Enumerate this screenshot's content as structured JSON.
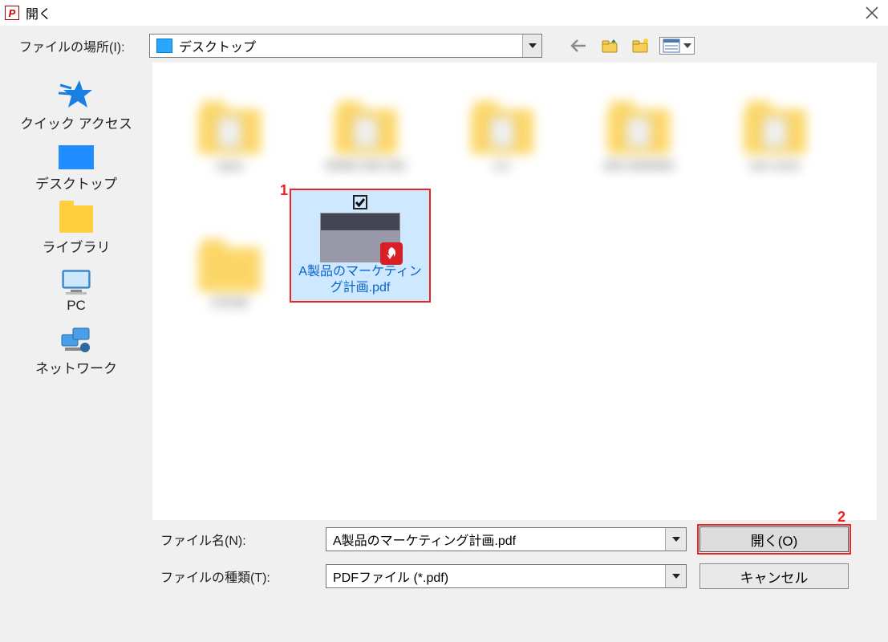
{
  "title": "開く",
  "locationLabel": "ファイルの場所(I):",
  "locationValue": "デスクトップ",
  "places": {
    "quick": "クイック アクセス",
    "desktop": "デスクトップ",
    "libraries": "ライブラリ",
    "pc": "PC",
    "network": "ネットワーク"
  },
  "selectedFile": "A製品のマーケティング計画.pdf",
  "callouts": {
    "one": "1",
    "two": "2"
  },
  "bottom": {
    "fileNameLabel": "ファイル名(N):",
    "fileNameValue": "A製品のマーケティング計画.pdf",
    "fileTypeLabel": "ファイルの種類(T):",
    "fileTypeValue": "PDFファイル (*.pdf)",
    "openBtn": "開く(O)",
    "cancelBtn": "キャンセル"
  }
}
